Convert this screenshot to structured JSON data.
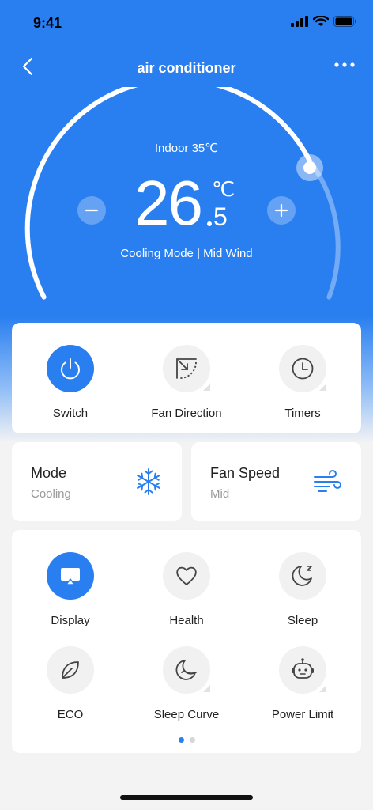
{
  "status_bar": {
    "time": "9:41"
  },
  "header": {
    "title": "air conditioner"
  },
  "dial": {
    "indoor_label": "Indoor 35℃",
    "temp_integer": "26",
    "temp_unit": "℃",
    "temp_decimal": "5",
    "mode_line": "Cooling Mode | Mid Wind"
  },
  "quick_controls": [
    {
      "label": "Switch",
      "icon": "power-icon",
      "active": true
    },
    {
      "label": "Fan Direction",
      "icon": "fan-direction-icon",
      "active": false
    },
    {
      "label": "Timers",
      "icon": "clock-icon",
      "active": false
    }
  ],
  "mode_card": {
    "title": "Mode",
    "value": "Cooling",
    "icon": "snowflake-icon"
  },
  "fan_card": {
    "title": "Fan Speed",
    "value": "Mid",
    "icon": "wind-icon"
  },
  "features": [
    {
      "label": "Display",
      "icon": "display-icon",
      "active": true
    },
    {
      "label": "Health",
      "icon": "heart-icon",
      "active": false
    },
    {
      "label": "Sleep",
      "icon": "moon-z-icon",
      "active": false
    },
    {
      "label": "ECO",
      "icon": "leaf-icon",
      "active": false
    },
    {
      "label": "Sleep Curve",
      "icon": "moon-curve-icon",
      "active": false
    },
    {
      "label": "Power Limit",
      "icon": "robot-icon",
      "active": false
    }
  ],
  "pagination": {
    "current": 1,
    "total": 2
  },
  "colors": {
    "primary": "#2a7ff0",
    "card": "#ffffff",
    "background": "#f3f3f3"
  }
}
